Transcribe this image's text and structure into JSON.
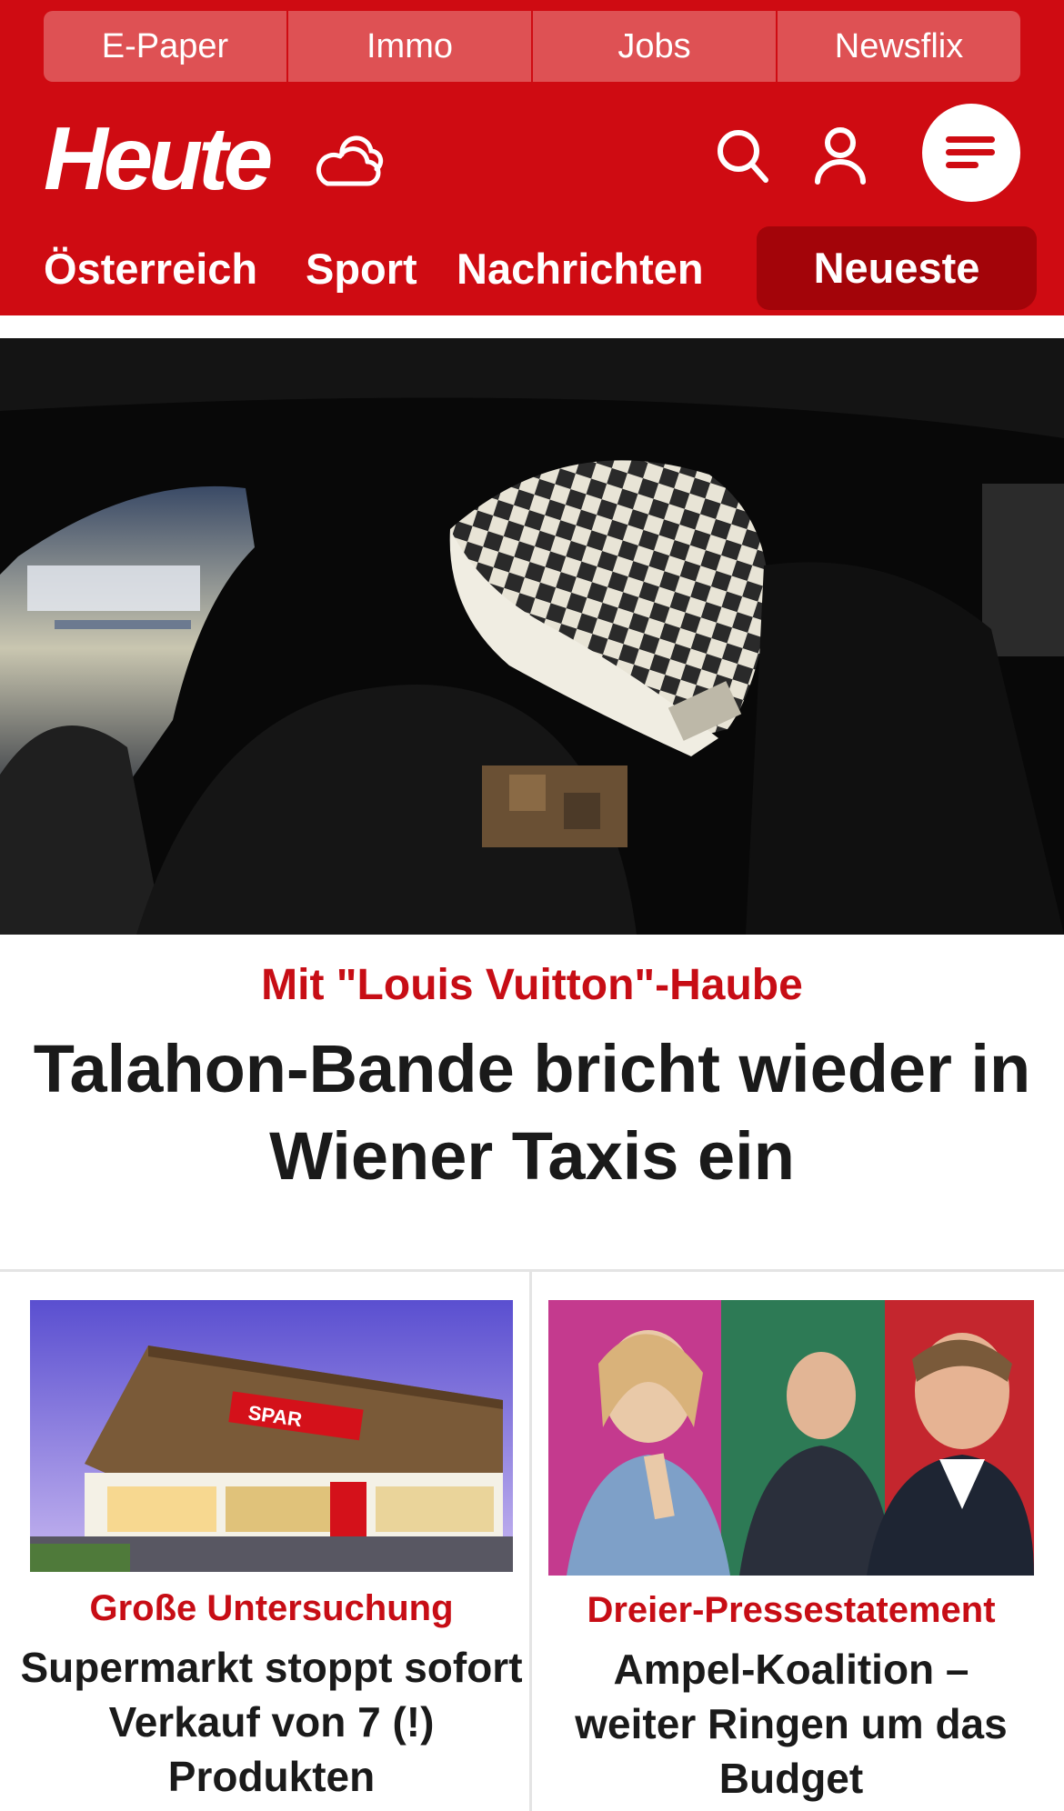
{
  "top_links": [
    "E-Paper",
    "Immo",
    "Jobs",
    "Newsflix"
  ],
  "brand": {
    "logo_text": "Heute"
  },
  "icons": {
    "weather": "cloud-weather-icon",
    "search": "search-icon",
    "account": "user-icon",
    "menu": "hamburger-menu-icon"
  },
  "nav": {
    "items": [
      "Österreich",
      "Sport",
      "Nachrichten"
    ],
    "active": "Neueste"
  },
  "colors": {
    "brand_red": "#cf0b12",
    "tab_light": "#de5154",
    "active_tab": "#a30409",
    "kicker_red": "#c70d15",
    "title_text": "#1a1a1a"
  },
  "hero": {
    "kicker": "Mit \"Louis Vuitton\"-Haube",
    "title": "Talahon-Bande bricht wieder in Wiener Taxis ein"
  },
  "cards": [
    {
      "kicker": "Große Untersuchung",
      "title": "Supermarkt stoppt sofort Verkauf von 7 (!) Produkten",
      "store_sign": "SPAR"
    },
    {
      "kicker": "Dreier-Pressestatement",
      "title": "Ampel-Koalition – weiter Ringen um das Budget"
    }
  ]
}
